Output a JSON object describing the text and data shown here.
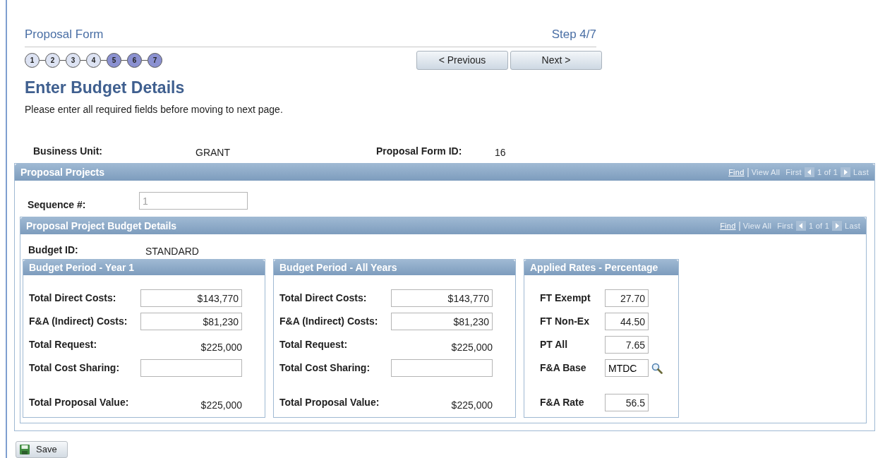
{
  "header": {
    "title": "Proposal Form",
    "step": "Step 4/7",
    "steps": [
      {
        "label": "1",
        "highlighted": false
      },
      {
        "label": "2",
        "highlighted": false
      },
      {
        "label": "3",
        "highlighted": false
      },
      {
        "label": "4",
        "highlighted": false
      },
      {
        "label": "5",
        "highlighted": true
      },
      {
        "label": "6",
        "highlighted": true
      },
      {
        "label": "7",
        "highlighted": true
      }
    ],
    "buttons": [
      "< Previous",
      "Next >"
    ],
    "heading": "Enter Budget Details",
    "instructions": "Please enter all required fields before moving to next page."
  },
  "key_fields": [
    {
      "label": "Business Unit:",
      "value": "GRANT"
    },
    {
      "label": "Proposal Form ID:",
      "value": "16"
    }
  ],
  "projects": {
    "title": "Proposal Projects",
    "nav": {
      "find": "Find",
      "view_all": "View All",
      "first": "First",
      "count": "1 of 1",
      "last": "Last"
    },
    "sequence": {
      "label": "Sequence #:",
      "value": "1",
      "disabled": true
    },
    "budget": {
      "title": "Proposal Project Budget Details",
      "nav": {
        "find": "Find",
        "view_all": "View All",
        "first": "First",
        "count": "1 of 1",
        "last": "Last"
      },
      "budget_id": {
        "label": "Budget ID:",
        "value": "STANDARD"
      },
      "panels": [
        {
          "title": "Budget Period - Year 1",
          "kind": "money",
          "rows": [
            {
              "label": "Total Direct Costs:",
              "kind": "field",
              "value": "$143,770"
            },
            {
              "label": "F&A (Indirect) Costs:",
              "kind": "field",
              "value": "$81,230"
            },
            {
              "label": "Total Request:",
              "kind": "text",
              "value": "$225,000"
            },
            {
              "label": "Total Cost Sharing:",
              "kind": "field"
            },
            {
              "label": "Total Proposal Value:",
              "kind": "text",
              "value": "$225,000"
            }
          ]
        },
        {
          "title": "Budget Period - All Years",
          "kind": "money",
          "rows": [
            {
              "label": "Total Direct Costs:",
              "kind": "field",
              "value": "$143,770"
            },
            {
              "label": "F&A (Indirect) Costs:",
              "kind": "field",
              "value": "$81,230"
            },
            {
              "label": "Total Request:",
              "kind": "text",
              "value": "$225,000"
            },
            {
              "label": "Total Cost Sharing:",
              "kind": "field"
            },
            {
              "label": "Total Proposal Value:",
              "kind": "text",
              "value": "$225,000"
            }
          ]
        },
        {
          "title": "Applied Rates - Percentage",
          "kind": "rates",
          "rows": [
            {
              "label": "FT Exempt",
              "kind": "field",
              "value": "27.70"
            },
            {
              "label": "FT Non-Ex",
              "kind": "field",
              "value": "44.50"
            },
            {
              "label": "PT All",
              "kind": "field",
              "value": "7.65"
            },
            {
              "label": "F&A Base",
              "kind": "lookup",
              "value": "MTDC"
            },
            {
              "label": "F&A Rate",
              "kind": "field",
              "value": "56.5"
            }
          ]
        }
      ]
    }
  },
  "save_button": "Save"
}
